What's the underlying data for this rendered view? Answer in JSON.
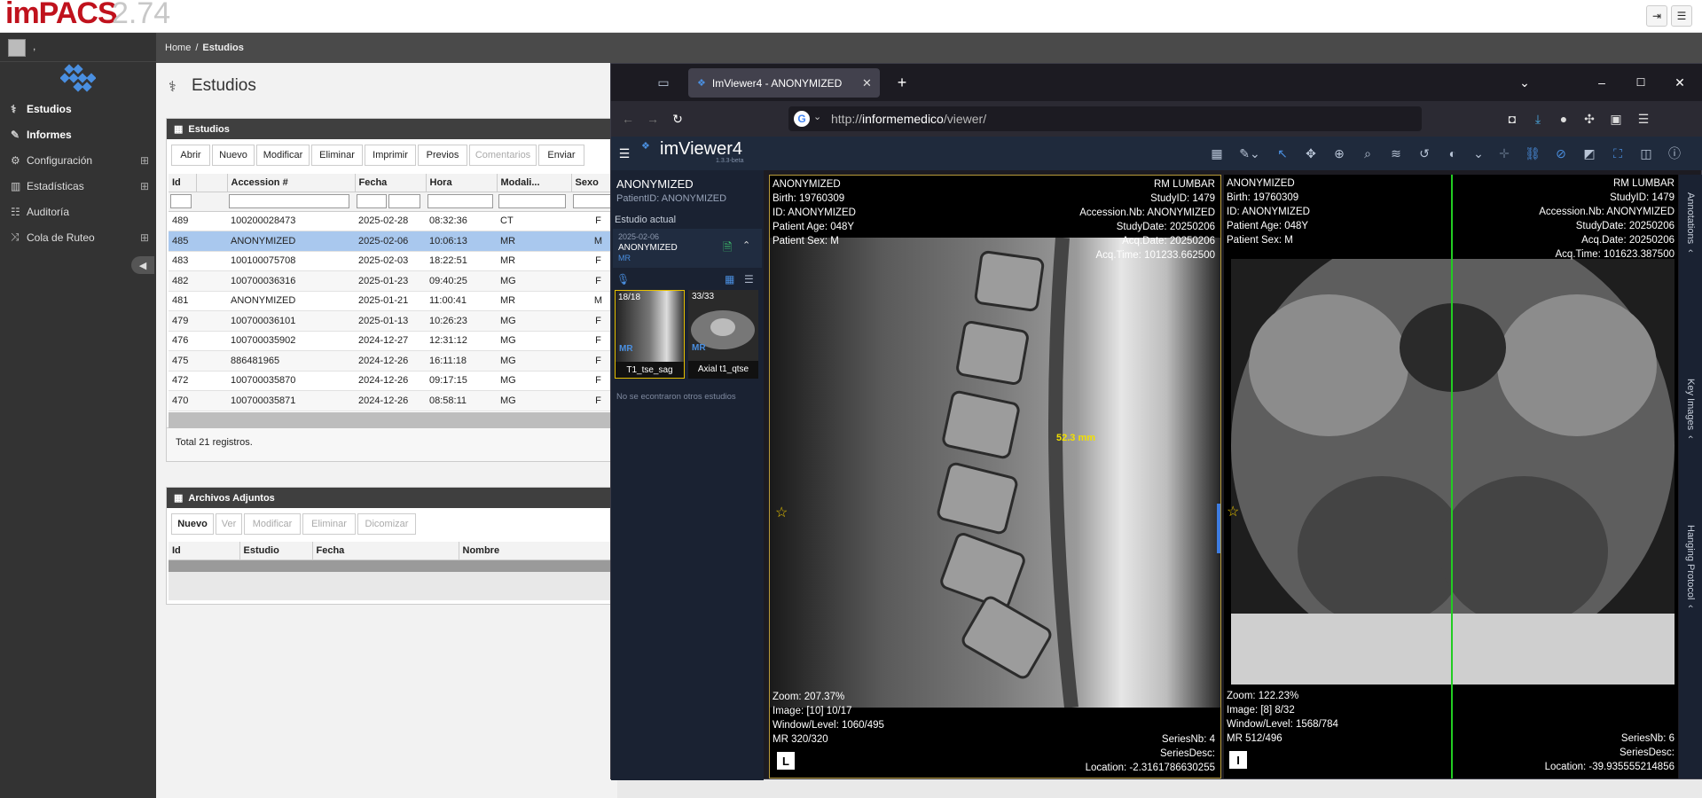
{
  "app": {
    "logo_main": "imPACS",
    "logo_version": "2.74",
    "user_name": ","
  },
  "sidebar": {
    "items": [
      {
        "label": "Estudios",
        "icon": "stethoscope-icon"
      },
      {
        "label": "Informes",
        "icon": "edit-icon"
      },
      {
        "label": "Configuración",
        "icon": "gear-icon"
      },
      {
        "label": "Estadísticas",
        "icon": "bar-chart-icon"
      },
      {
        "label": "Auditoría",
        "icon": "list-icon"
      },
      {
        "label": "Cola de Ruteo",
        "icon": "shuffle-icon"
      }
    ]
  },
  "breadcrumb": {
    "home": "Home",
    "sep": "/",
    "current": "Estudios"
  },
  "page": {
    "title": "Estudios"
  },
  "studies_panel": {
    "title": "Estudios",
    "toolbar": [
      "Abrir",
      "Nuevo",
      "Modificar",
      "Eliminar",
      "Imprimir",
      "Previos",
      "Comentarios",
      "Enviar"
    ],
    "columns": [
      "Id",
      "Accession #",
      "Fecha",
      "Hora",
      "Modali...",
      "Sexo"
    ],
    "rows": [
      {
        "id": "489",
        "acc": "100200028473",
        "fecha": "2025-02-28",
        "hora": "08:32:36",
        "mod": "CT",
        "sexo": "F"
      },
      {
        "id": "485",
        "acc": "ANONYMIZED",
        "fecha": "2025-02-06",
        "hora": "10:06:13",
        "mod": "MR",
        "sexo": "M"
      },
      {
        "id": "483",
        "acc": "100100075708",
        "fecha": "2025-02-03",
        "hora": "18:22:51",
        "mod": "MR",
        "sexo": "F"
      },
      {
        "id": "482",
        "acc": "100700036316",
        "fecha": "2025-01-23",
        "hora": "09:40:25",
        "mod": "MG",
        "sexo": "F"
      },
      {
        "id": "481",
        "acc": "ANONYMIZED",
        "fecha": "2025-01-21",
        "hora": "11:00:41",
        "mod": "MR",
        "sexo": "M"
      },
      {
        "id": "479",
        "acc": "100700036101",
        "fecha": "2025-01-13",
        "hora": "10:26:23",
        "mod": "MG",
        "sexo": "F"
      },
      {
        "id": "476",
        "acc": "100700035902",
        "fecha": "2024-12-27",
        "hora": "12:31:12",
        "mod": "MG",
        "sexo": "F"
      },
      {
        "id": "475",
        "acc": "886481965",
        "fecha": "2024-12-26",
        "hora": "16:11:18",
        "mod": "MG",
        "sexo": "F"
      },
      {
        "id": "472",
        "acc": "100700035870",
        "fecha": "2024-12-26",
        "hora": "09:17:15",
        "mod": "MG",
        "sexo": "F"
      },
      {
        "id": "470",
        "acc": "100700035871",
        "fecha": "2024-12-26",
        "hora": "08:58:11",
        "mod": "MG",
        "sexo": "F"
      }
    ],
    "total": "Total 21 registros."
  },
  "attachments_panel": {
    "title": "Archivos Adjuntos",
    "toolbar": [
      "Nuevo",
      "Ver",
      "Modificar",
      "Eliminar",
      "Dicomizar"
    ],
    "columns": [
      "Id",
      "Estudio",
      "Fecha",
      "Nombre"
    ]
  },
  "browser": {
    "tab_title": "ImViewer4 - ANONYMIZED",
    "url_prefix": "http://",
    "url_host": "informemedico",
    "url_path": "/viewer/"
  },
  "viewer": {
    "name": "imViewer4",
    "version": "1.3.3-beta",
    "patient_name": "ANONYMIZED",
    "patient_id": "PatientID: ANONYMIZED",
    "current_study_label": "Estudio actual",
    "study_date": "2025-02-06",
    "study_name": "ANONYMIZED",
    "study_modality": "MR",
    "series": [
      {
        "count": "18/18",
        "name": "T1_tse_sag",
        "mod": "MR"
      },
      {
        "count": "33/33",
        "name": "Axial t1_qtse",
        "mod": "MR"
      }
    ],
    "no_other": "No se econtraron otros estudios",
    "side_tabs": [
      "Annotations",
      "Key Images",
      "Hanging Protocol"
    ],
    "left_pane": {
      "tl": [
        "ANONYMIZED",
        "Birth: 19760309",
        "ID: ANONYMIZED",
        "Patient Age: 048Y",
        "Patient Sex: M"
      ],
      "tr": [
        "RM LUMBAR",
        "StudyID: 1479",
        "Accession.Nb: ANONYMIZED",
        "StudyDate: 20250206",
        "Acq.Date: 20250206",
        "Acq.Time: 101233.662500"
      ],
      "bl": [
        "Zoom: 207.37%",
        "Image: [10] 10/17",
        "Window/Level: 1060/495",
        "MR 320/320"
      ],
      "br": [
        "SeriesNb: 4",
        "SeriesDesc:",
        "Location: -2.3161786630255"
      ],
      "measure": "52.3 mm",
      "orientation": "L"
    },
    "right_pane": {
      "tl": [
        "ANONYMIZED",
        "Birth: 19760309",
        "ID: ANONYMIZED",
        "Patient Age: 048Y",
        "Patient Sex: M"
      ],
      "tr": [
        "RM LUMBAR",
        "StudyID: 1479",
        "Accession.Nb: ANONYMIZED",
        "StudyDate: 20250206",
        "Acq.Date: 20250206",
        "Acq.Time: 101623.387500"
      ],
      "bl": [
        "Zoom: 122.23%",
        "Image: [8] 8/32",
        "Window/Level: 1568/784",
        "MR 512/496"
      ],
      "br": [
        "SeriesNb: 6",
        "SeriesDesc:",
        "Location: -39.935555214856"
      ],
      "orientation": "I"
    }
  },
  "colors": {
    "accent_blue": "#4a8fe0",
    "selected_row": "#a9c8ee",
    "brand_red": "#c0121d"
  }
}
